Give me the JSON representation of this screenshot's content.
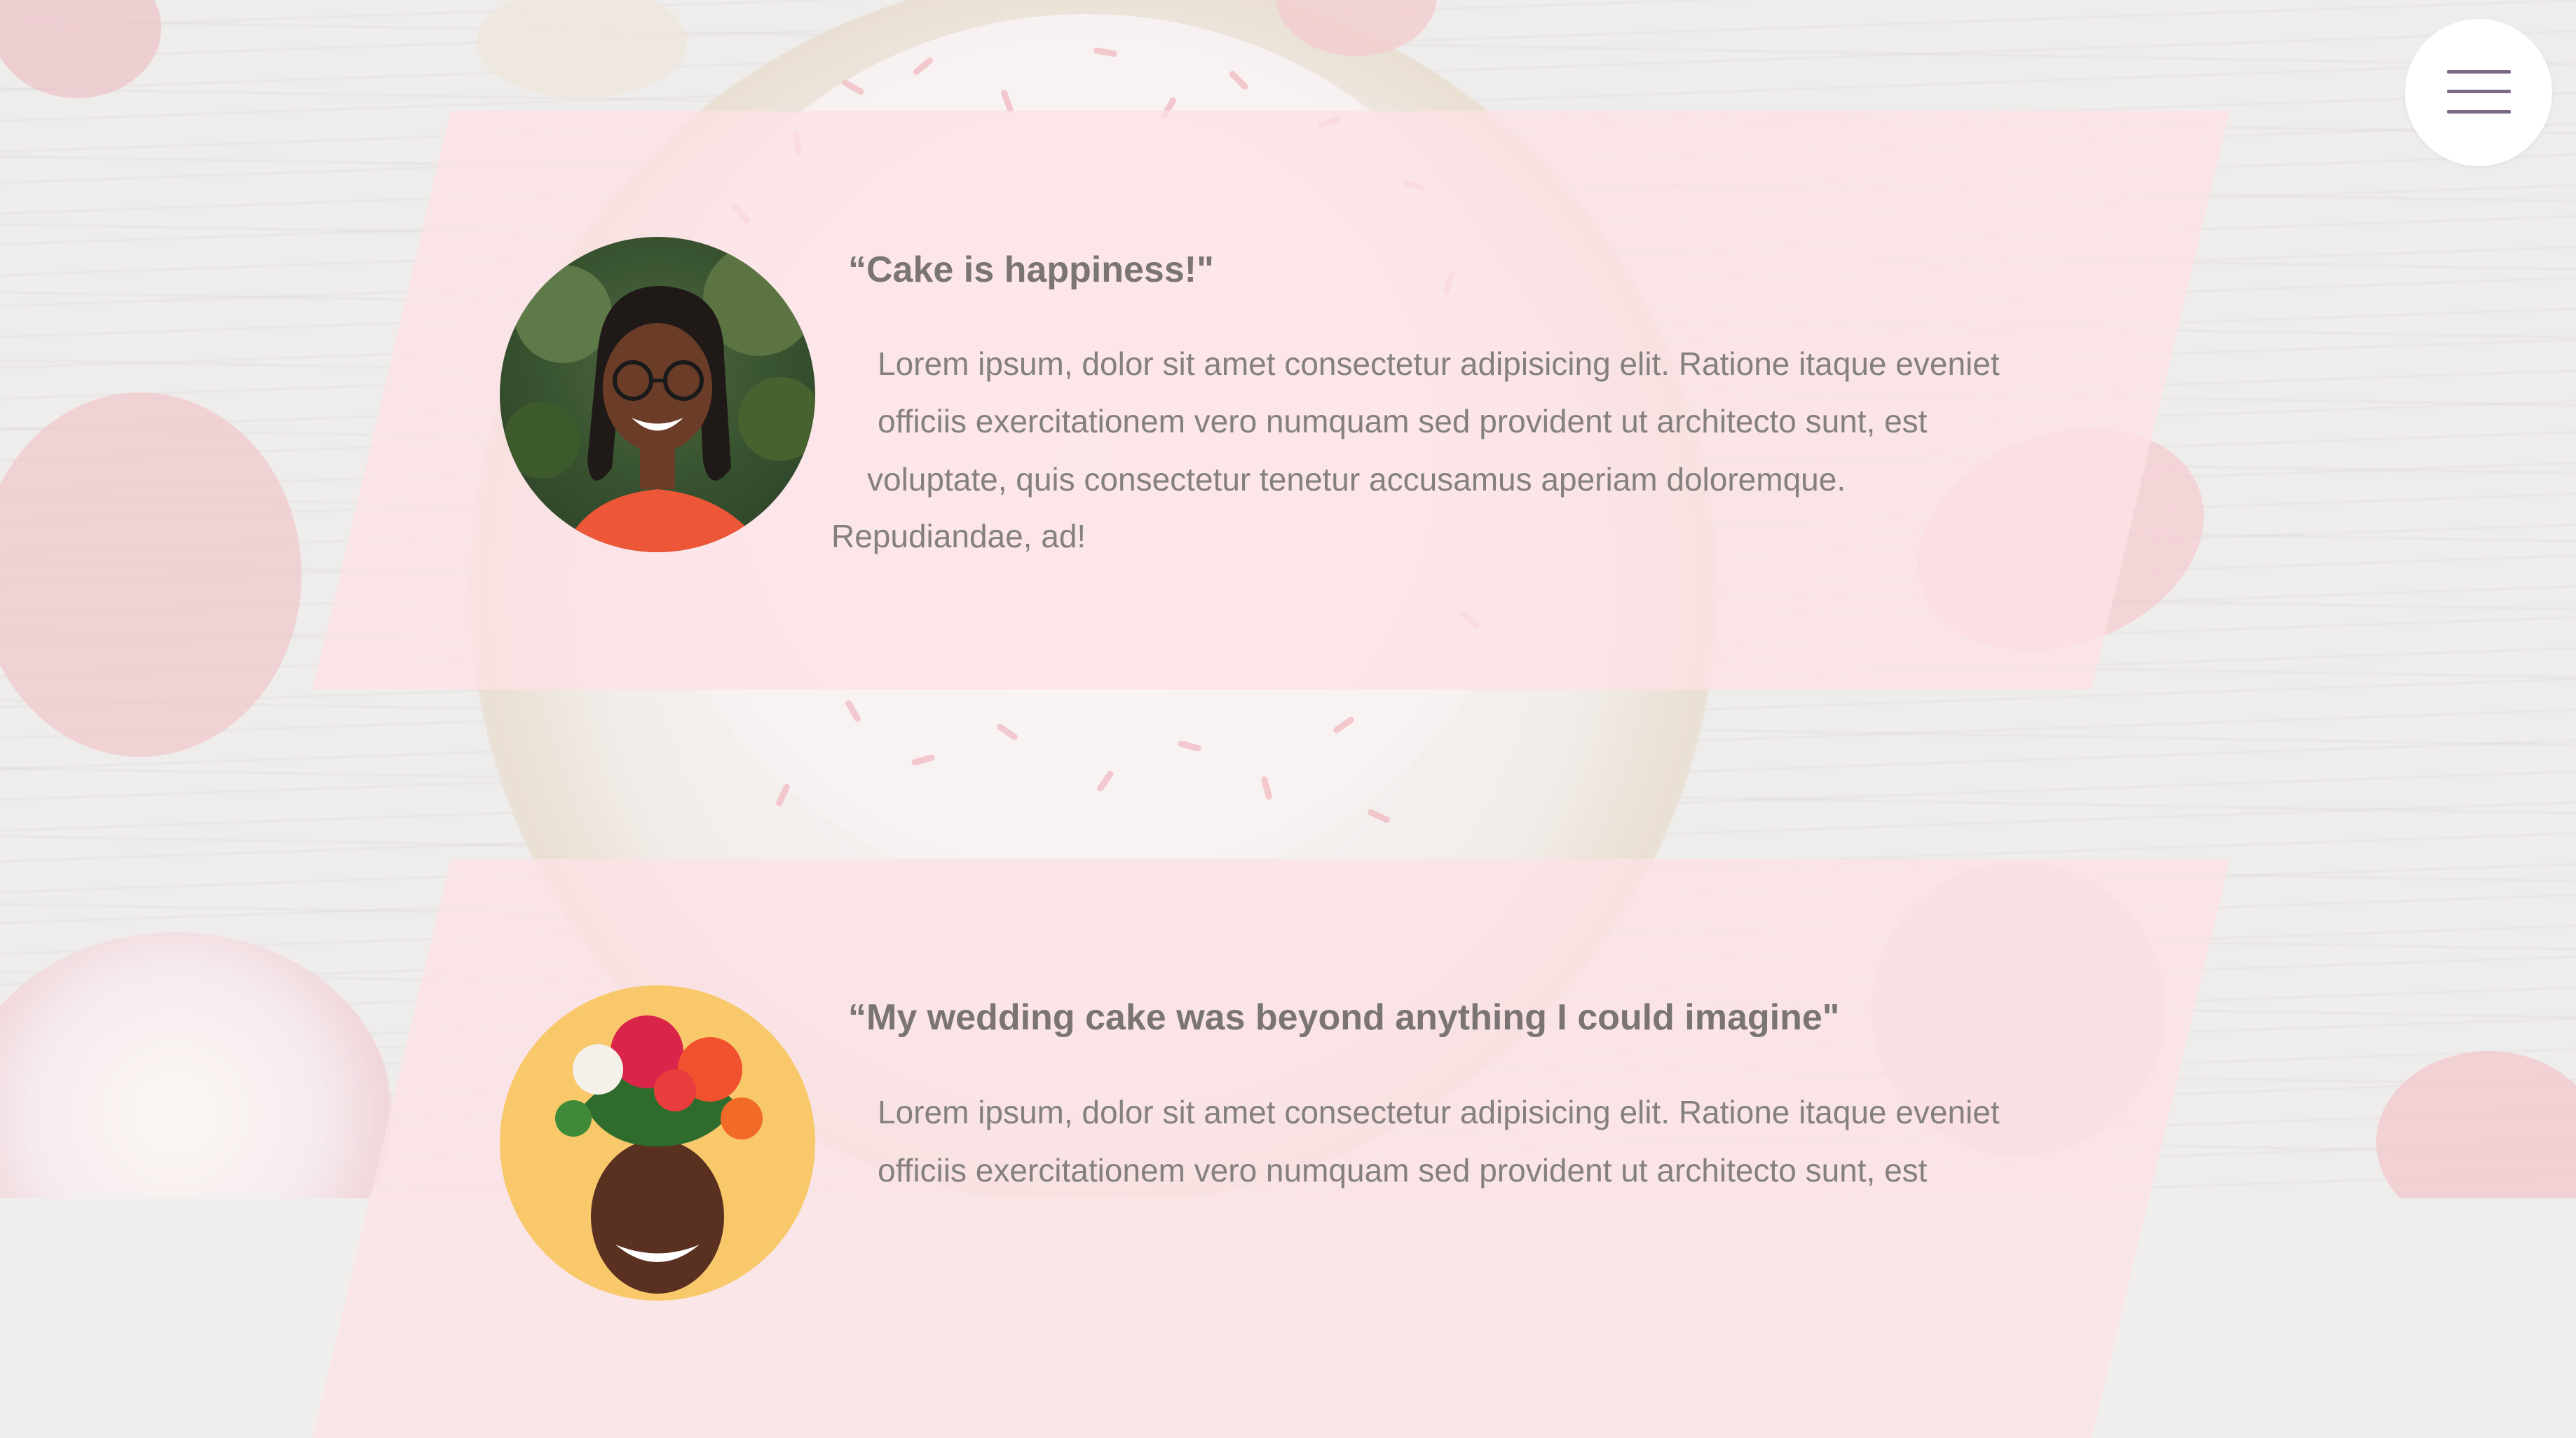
{
  "menu": {
    "icon": "hamburger-menu-icon"
  },
  "testimonials": [
    {
      "avatar": "woman-with-glasses-photo",
      "title": "“Cake is happiness!\"",
      "body_lines": [
        "Lorem ipsum, dolor sit amet consectetur adipisicing elit. Ratione itaque eveniet",
        "officiis exercitationem vero numquam sed provident ut architecto sunt, est",
        "voluptate, quis consectetur tenetur accusamus aperiam doloremque.",
        "Repudiandae, ad!"
      ]
    },
    {
      "avatar": "woman-with-flower-crown-photo",
      "title": "“My wedding cake was beyond anything I could imagine\"",
      "body_lines": [
        "Lorem ipsum, dolor sit amet consectetur adipisicing elit. Ratione itaque eveniet",
        "officiis exercitationem vero numquam sed provident ut architecto sunt, est"
      ]
    }
  ],
  "colors": {
    "card": "#fce2e6",
    "title_text": "#7b7474",
    "body_text": "#858080",
    "menu_lines": "#7a6a86"
  }
}
